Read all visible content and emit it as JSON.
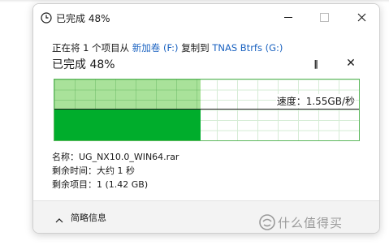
{
  "window": {
    "title": "已完成 48%",
    "icon": "clock-icon"
  },
  "copy": {
    "prefix": "正在将 1 个项目从",
    "source": "新加卷 (F:)",
    "middle": "复制到",
    "destination": "TNAS Btrfs  (G:)"
  },
  "progress": {
    "label": "已完成 48%",
    "percent": 48,
    "speed_label": "速度：1.55GB/秒",
    "speed_level_fraction": 0.49
  },
  "controls": {
    "pause": "‖",
    "close": "✕"
  },
  "details": {
    "name": "名称：UG_NX10.0_WIN64.rar",
    "time_remaining": "剩余时间：大约 1 秒",
    "items_remaining": "剩余项目：1 (1.42 GB)"
  },
  "footer": {
    "label": "简略信息",
    "icon": "chevron-up-icon"
  },
  "watermark": {
    "text": "什么值得买"
  },
  "colors": {
    "progress_light": "#a9e29a",
    "progress_solid": "#00ad2c",
    "link": "#1a62c0"
  }
}
